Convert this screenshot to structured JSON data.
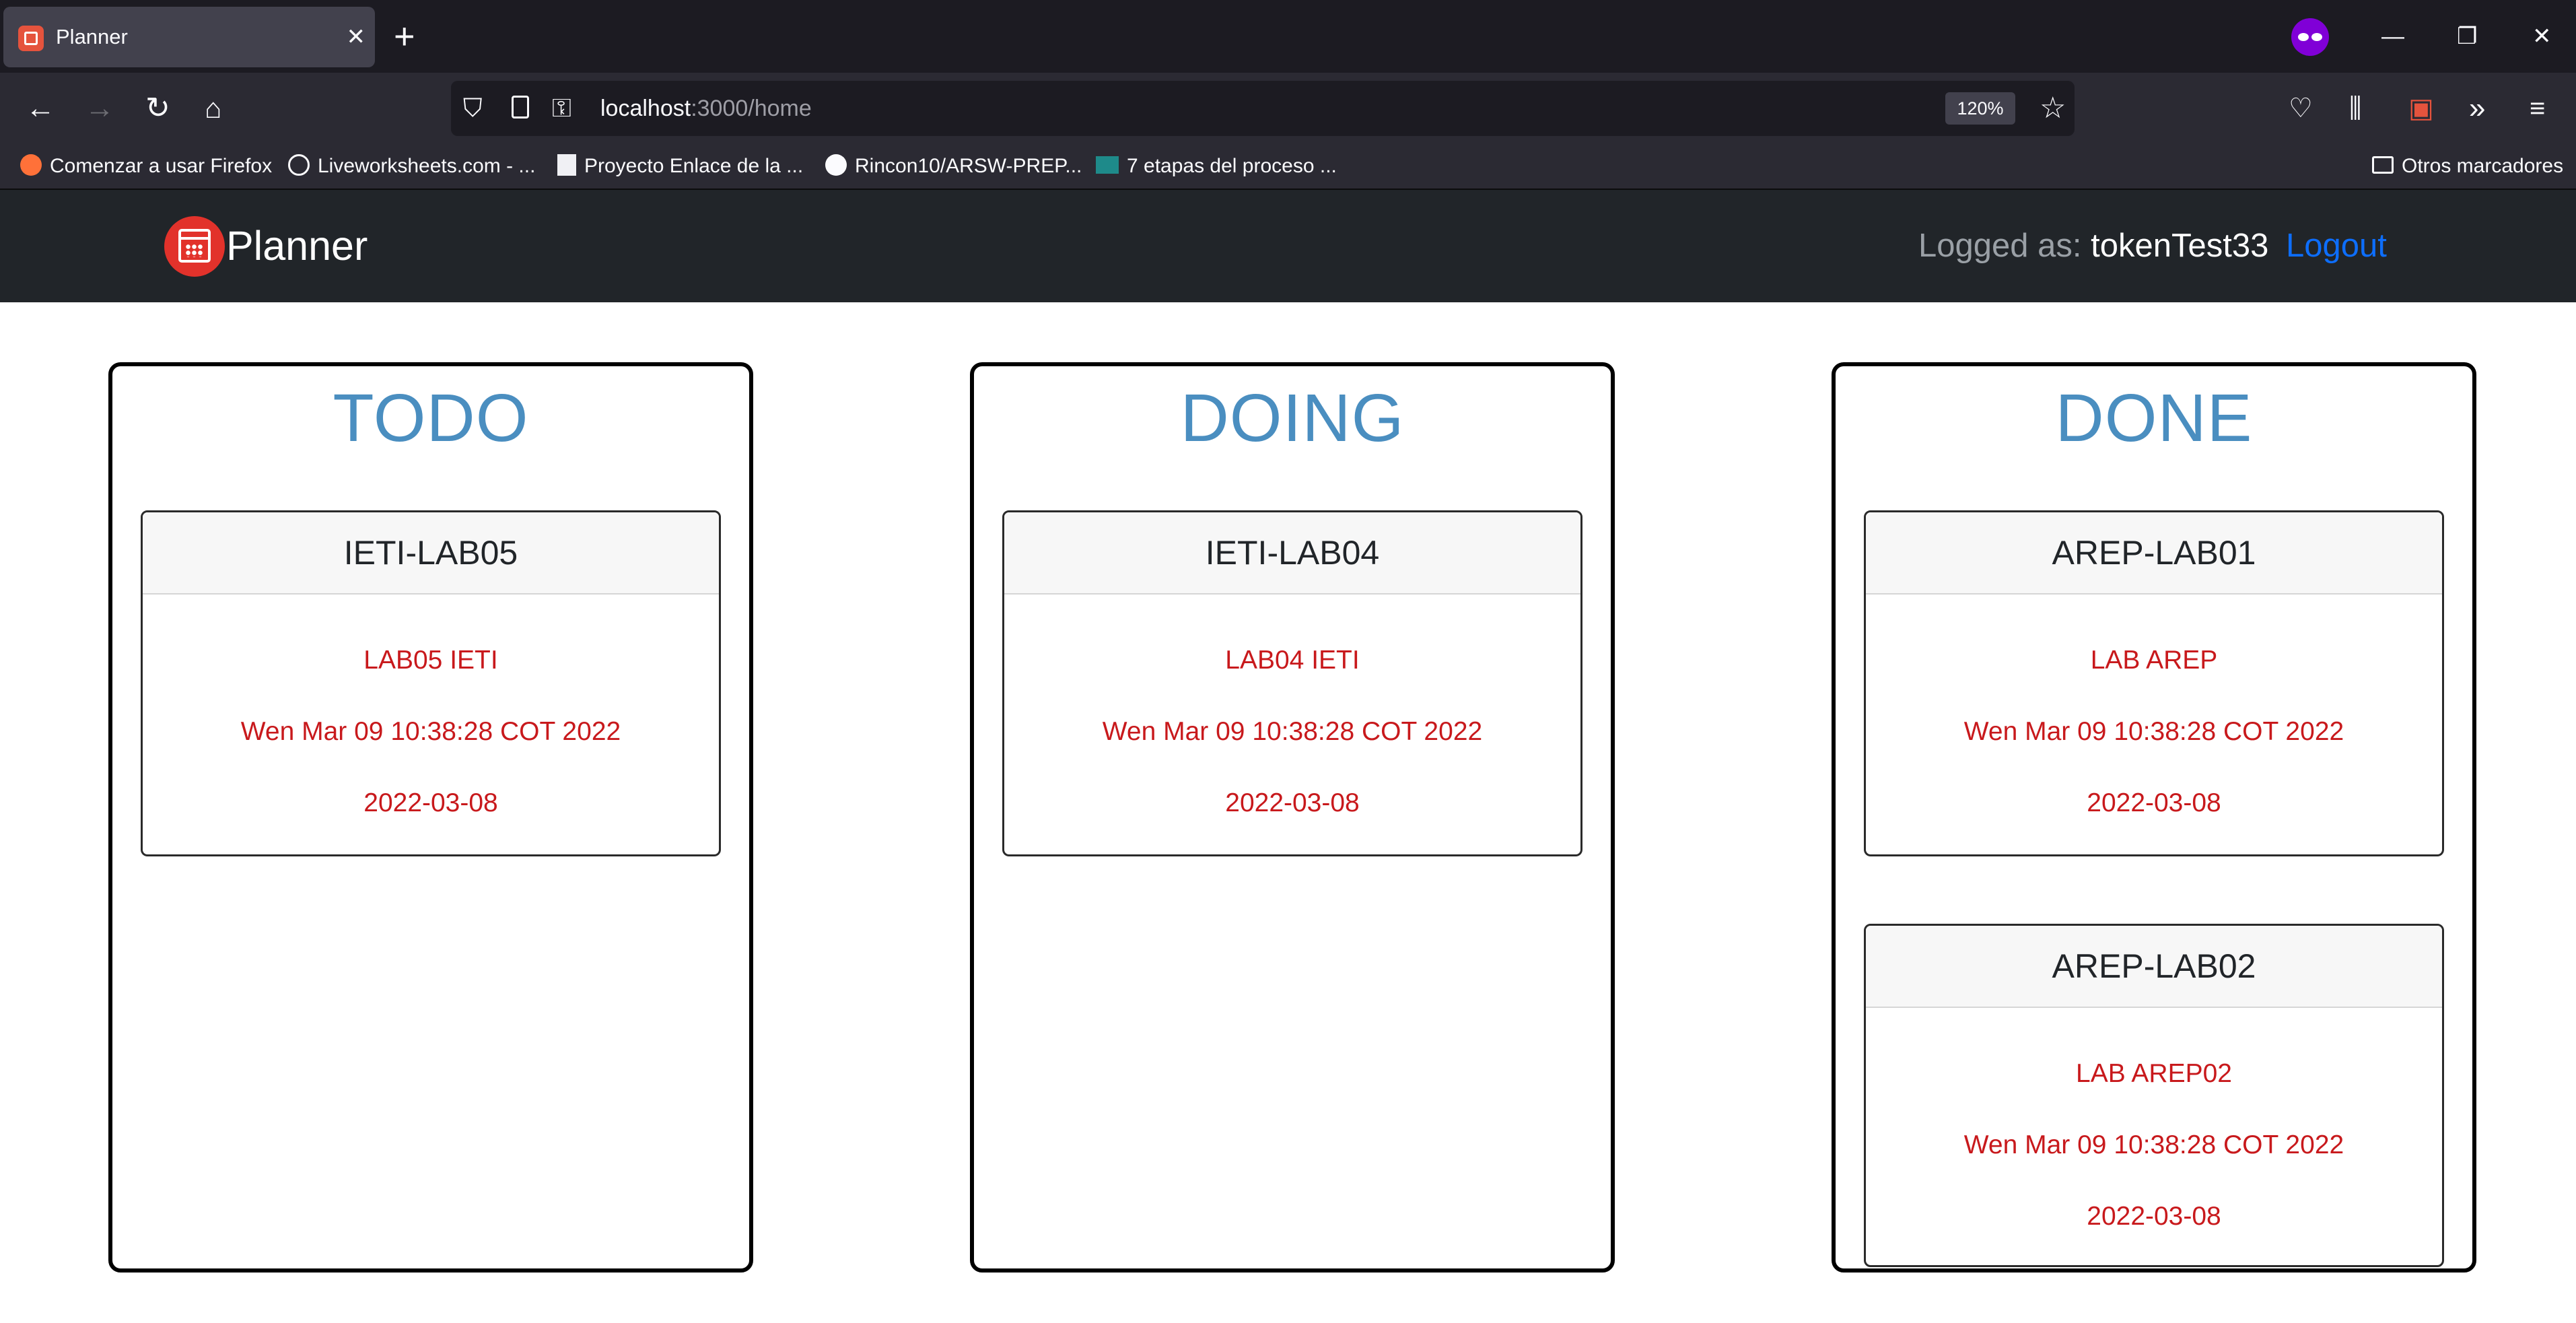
{
  "browser": {
    "tab_title": "Planner",
    "tab_close": "✕",
    "new_tab": "+",
    "url_host": "localhost",
    "url_path": ":3000/home",
    "zoom": "120%",
    "bookmarks": [
      {
        "label": "Comenzar a usar Firefox",
        "icon": "firefox-icon"
      },
      {
        "label": "Liveworksheets.com - ...",
        "icon": "globe-icon"
      },
      {
        "label": "Proyecto Enlace de la ...",
        "icon": "page-icon"
      },
      {
        "label": "Rincon10/ARSW-PREP...",
        "icon": "github-icon"
      },
      {
        "label": "7 etapas del proceso ...",
        "icon": "zz-icon"
      }
    ],
    "other_bookmarks": "Otros marcadores"
  },
  "app": {
    "brand": "Planner",
    "logged_label": "Logged as: ",
    "username": "tokenTest33",
    "logout": "Logout",
    "columns": [
      {
        "title": "TODO",
        "cards": [
          {
            "name": "IETI-LAB05",
            "description": "LAB05 IETI",
            "created": "Wen Mar 09 10:38:28 COT 2022",
            "due": "2022-03-08"
          }
        ]
      },
      {
        "title": "DOING",
        "cards": [
          {
            "name": "IETI-LAB04",
            "description": "LAB04 IETI",
            "created": "Wen Mar 09 10:38:28 COT 2022",
            "due": "2022-03-08"
          }
        ]
      },
      {
        "title": "DONE",
        "cards": [
          {
            "name": "AREP-LAB01",
            "description": "LAB AREP",
            "created": "Wen Mar 09 10:38:28 COT 2022",
            "due": "2022-03-08"
          },
          {
            "name": "AREP-LAB02",
            "description": "LAB AREP02",
            "created": "Wen Mar 09 10:38:28 COT 2022",
            "due": "2022-03-08"
          }
        ]
      }
    ]
  }
}
